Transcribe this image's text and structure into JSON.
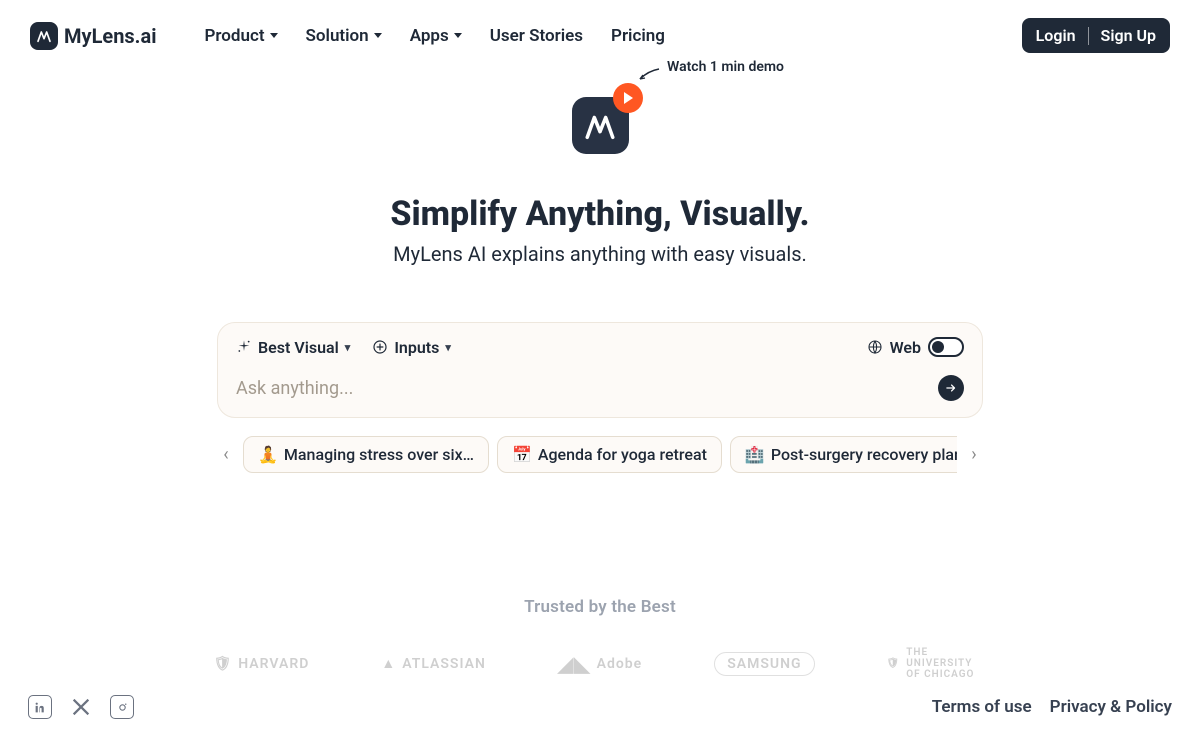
{
  "brand": {
    "name": "MyLens.ai"
  },
  "nav": {
    "product": "Product",
    "solution": "Solution",
    "apps": "Apps",
    "user_stories": "User Stories",
    "pricing": "Pricing"
  },
  "auth": {
    "login": "Login",
    "signup": "Sign Up"
  },
  "demo_label": "Watch 1 min demo",
  "headline": "Simplify Anything, Visually.",
  "subhead": "MyLens AI explains anything with easy visuals.",
  "search": {
    "best_visual": "Best Visual",
    "inputs": "Inputs",
    "web_label": "Web",
    "placeholder": "Ask anything...",
    "value": ""
  },
  "chips": [
    {
      "emoji": "🧘",
      "label": "Managing stress over six…"
    },
    {
      "emoji": "📅",
      "label": "Agenda for yoga retreat"
    },
    {
      "emoji": "🏥",
      "label": "Post-surgery recovery plan"
    }
  ],
  "trusted_heading": "Trusted by the Best",
  "brands": [
    "HARVARD",
    "ATLASSIAN",
    "Adobe",
    "SAMSUNG",
    "THE UNIVERSITY OF CHICAGO"
  ],
  "footer": {
    "terms": "Terms of use",
    "privacy": "Privacy & Policy"
  }
}
